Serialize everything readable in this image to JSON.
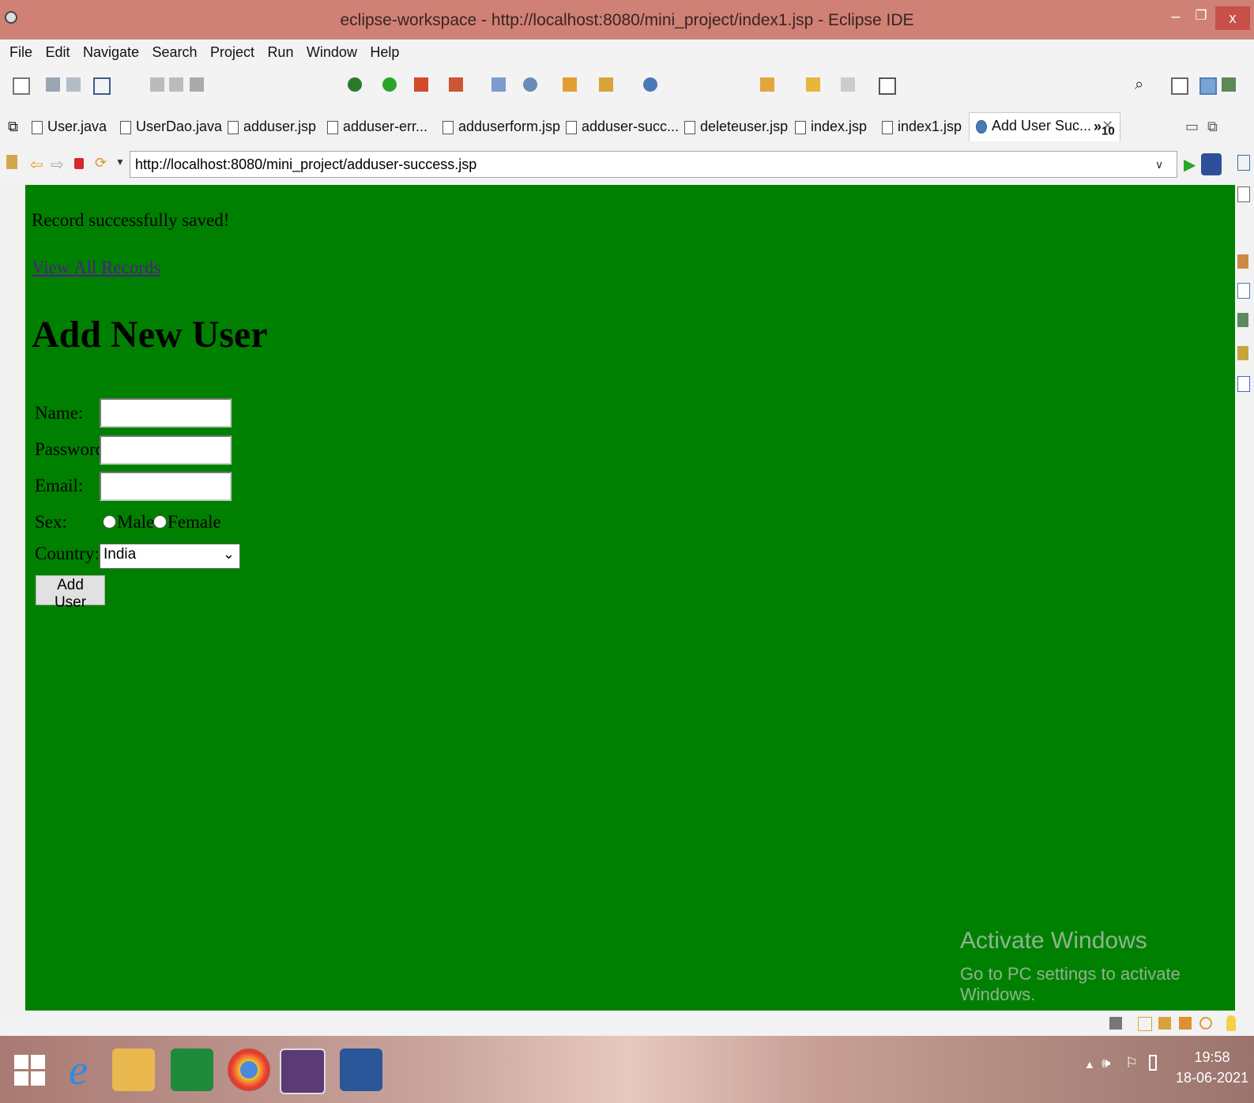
{
  "window": {
    "title": "eclipse-workspace - http://localhost:8080/mini_project/index1.jsp - Eclipse IDE",
    "min": "–",
    "max": "❐",
    "close": "x"
  },
  "menu": [
    "File",
    "Edit",
    "Navigate",
    "Search",
    "Project",
    "Run",
    "Window",
    "Help"
  ],
  "tabs": [
    "User.java",
    "UserDao.java",
    "adduser.jsp",
    "adduser-err...",
    "adduserform.jsp",
    "adduser-succ...",
    "deleteuser.jsp",
    "index.jsp",
    "index1.jsp",
    "Add User Suc..."
  ],
  "tabs_overflow": "10",
  "browser": {
    "url": "http://localhost:8080/mini_project/adduser-success.jsp"
  },
  "page": {
    "message": "Record successfully saved!",
    "view_link": "View All Records",
    "heading": "Add New User",
    "labels": {
      "name": "Name:",
      "password": "Password:",
      "email": "Email:",
      "sex": "Sex:",
      "male": "Male",
      "female": "Female",
      "country": "Country:"
    },
    "country_selected": "India",
    "submit": "Add User",
    "background": "#008000"
  },
  "watermark": {
    "line1": "Activate Windows",
    "line2": "Go to PC settings to activate Windows."
  },
  "clock": {
    "time": "19:58",
    "date": "18-06-2021"
  }
}
